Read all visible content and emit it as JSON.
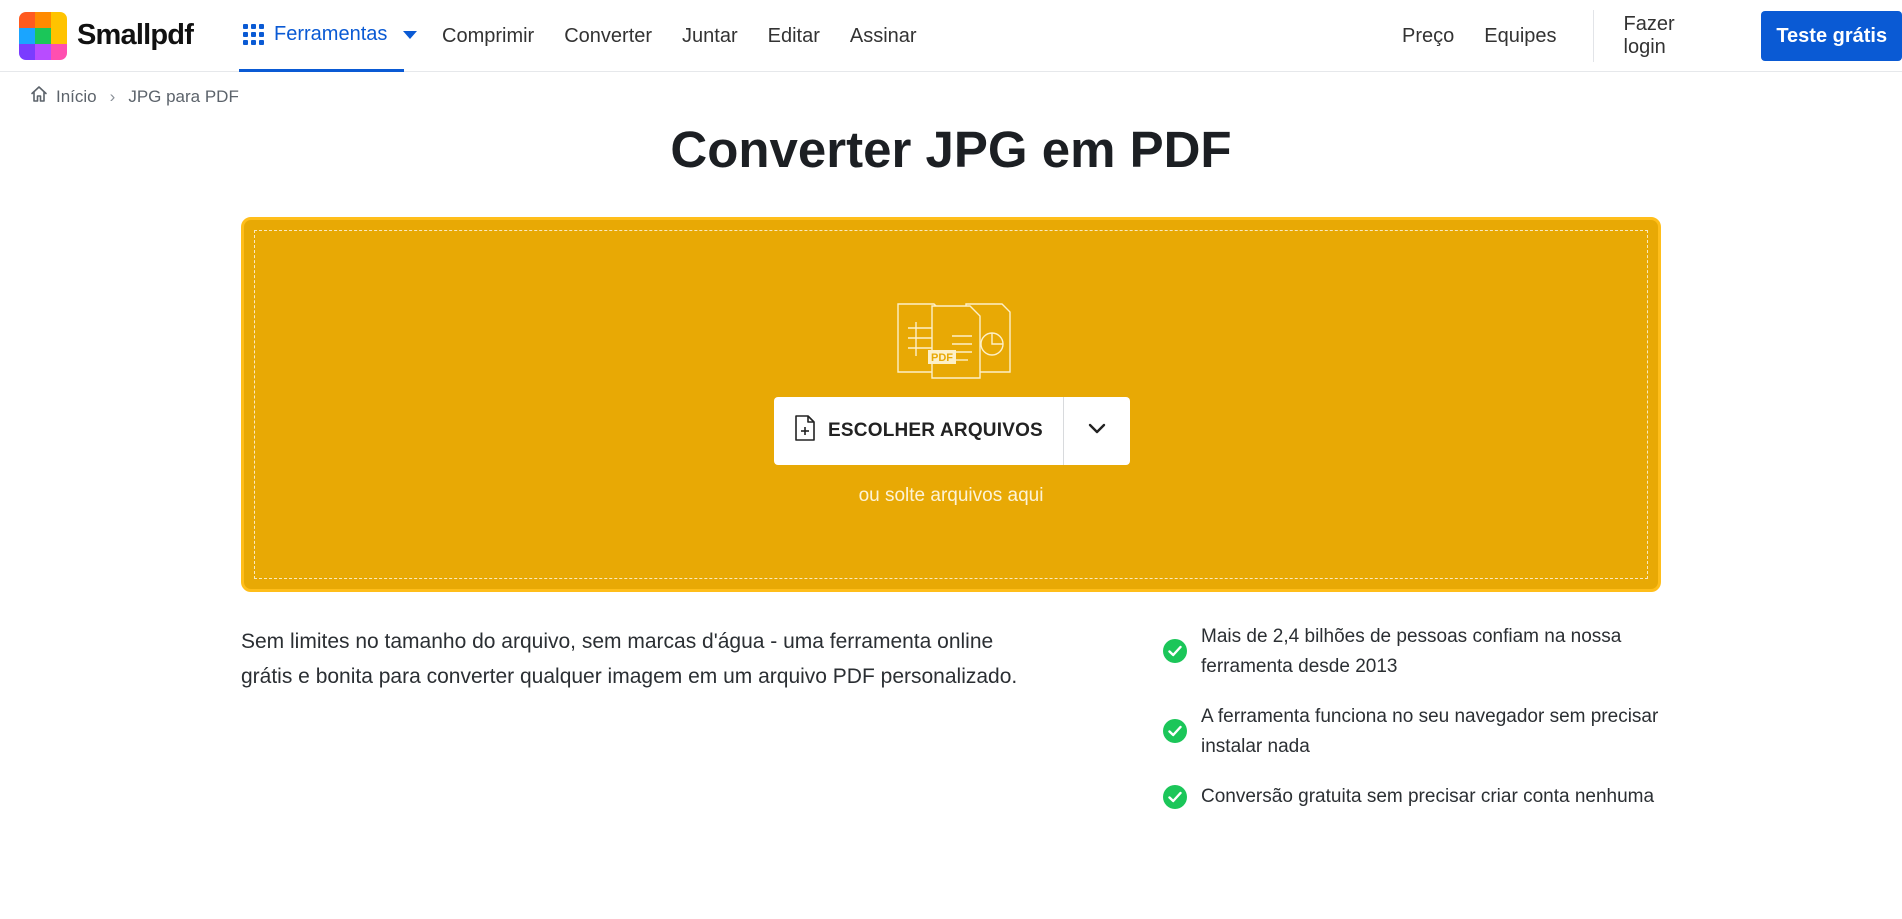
{
  "header": {
    "brand": "Smallpdf",
    "logo_colors": [
      "#ff5a1f",
      "#ff8a00",
      "#ffc300",
      "#1aa5ff",
      "#1bc659",
      "#ffc300",
      "#7a3cff",
      "#b84cff",
      "#ff4fb0"
    ],
    "tools_label": "Ferramentas",
    "nav": [
      "Comprimir",
      "Converter",
      "Juntar",
      "Editar",
      "Assinar"
    ],
    "price_label": "Preço",
    "teams_label": "Equipes",
    "login_label": "Fazer login",
    "cta_label": "Teste grátis"
  },
  "breadcrumb": {
    "home_label": "Início",
    "separator": "›",
    "current": "JPG para PDF"
  },
  "page": {
    "title": "Converter JPG em PDF"
  },
  "dropzone": {
    "choose_label": "ESCOLHER ARQUIVOS",
    "hint": "ou solte arquivos aqui",
    "illus_label": "PDF",
    "color": "#e8a905"
  },
  "description": "Sem limites no tamanho do arquivo, sem marcas d'água - uma ferramenta online grátis e bonita para converter qualquer imagem em um arquivo PDF personalizado.",
  "features": [
    "Mais de 2,4 bilhões de pessoas confiam na nossa ferramenta desde 2013",
    "A ferramenta funciona no seu navegador sem precisar instalar nada",
    "Conversão gratuita sem precisar criar conta nenhuma"
  ],
  "accent": "#0a5ad4",
  "check_color": "#1bc659"
}
